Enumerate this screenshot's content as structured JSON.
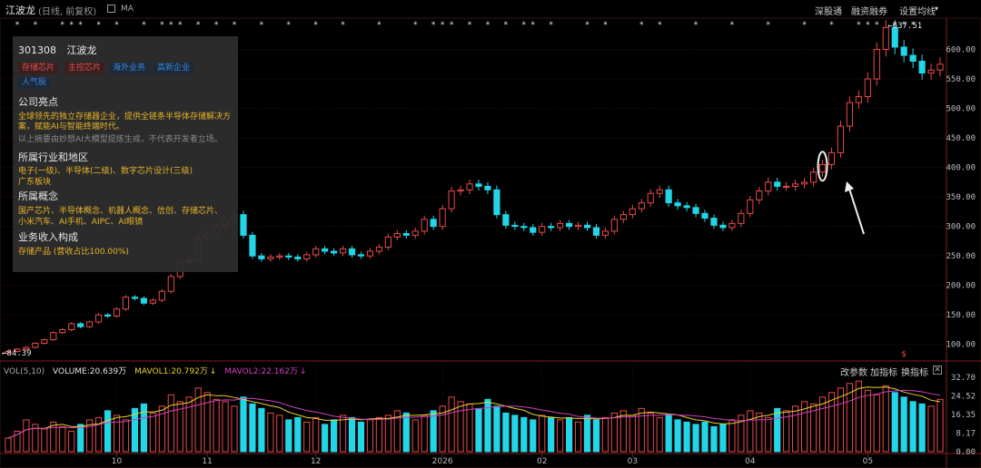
{
  "header": {
    "stock_name": "江波龙",
    "subtitle": "(日线, 前复权)",
    "indicator": "MA",
    "buttons": [
      "深股通",
      "融资融券",
      "设置均线"
    ]
  },
  "info_panel": {
    "code": "301308",
    "name": "江波龙",
    "tags": [
      {
        "label": "存储芯片",
        "color": "red"
      },
      {
        "label": "主控芯片",
        "color": "red"
      },
      {
        "label": "海外业务",
        "color": "blue"
      },
      {
        "label": "高新企业",
        "color": "blue"
      },
      {
        "label": "人气股",
        "color": "blue"
      }
    ],
    "highlights_title": "公司亮点",
    "highlights_line1": "全球领先的独立存储器企业，提供全链条半导体存储解决方",
    "highlights_line2": "案，赋能AI与智能终端时代。",
    "disclaimer": "以上摘要由妙想AI大模型提炼生成，不代表开发者立场。",
    "industry_title": "所属行业和地区",
    "industry_line1": "电子(一级)、半导体(二级)、数字芯片设计(三级)",
    "industry_line2": "广东板块",
    "concepts_title": "所属概念",
    "concepts_line1": "国产芯片、半导体概念、机器人概念、信创、存储芯片、",
    "concepts_line2": "小米汽车、AI手机、AIPC、AI眼镜",
    "revenue_title": "业务收入构成",
    "revenue_text": "存储产品 (营收占比100.00%)"
  },
  "volume_header": {
    "label": "VOL(5,10)",
    "vol": "VOLUME:20.639万",
    "mavol1": "MAVOL1:20.792万",
    "mavol2": "MAVOL2:22.162万",
    "buttons": [
      "改参数",
      "加指标",
      "换指标"
    ],
    "close": "✕"
  },
  "chart_data": {
    "type": "candlestick",
    "price_axis_ticks": [
      "600.00",
      "550.00",
      "500.00",
      "450.00",
      "400.00",
      "350.00",
      "300.00",
      "250.00",
      "200.00",
      "150.00",
      "100.00"
    ],
    "volume_axis_ticks": [
      "32.70",
      "24.52",
      "16.35",
      "8.17",
      "0.00"
    ],
    "x_ticks": [
      {
        "label": "10",
        "index": 12
      },
      {
        "label": "11",
        "index": 22
      },
      {
        "label": "12",
        "index": 34
      },
      {
        "label": "2026",
        "index": 48
      },
      {
        "label": "02",
        "index": 59
      },
      {
        "label": "03",
        "index": 69
      },
      {
        "label": "04",
        "index": 82
      },
      {
        "label": "05",
        "index": 95
      }
    ],
    "price_range": [
      75,
      650
    ],
    "volume_range": [
      0,
      32.7
    ],
    "high_label": "637.51",
    "low_label": "84.39",
    "close": [
      88,
      92,
      95,
      102,
      108,
      120,
      125,
      135,
      130,
      138,
      150,
      148,
      160,
      180,
      178,
      170,
      175,
      190,
      215,
      240,
      242,
      280,
      288,
      300,
      310,
      320,
      285,
      250,
      245,
      248,
      250,
      248,
      245,
      252,
      262,
      258,
      255,
      262,
      252,
      250,
      258,
      265,
      282,
      288,
      285,
      292,
      312,
      300,
      330,
      360,
      362,
      372,
      368,
      362,
      320,
      302,
      300,
      298,
      290,
      300,
      298,
      305,
      300,
      302,
      298,
      285,
      292,
      312,
      320,
      330,
      340,
      356,
      362,
      340,
      335,
      332,
      322,
      314,
      302,
      298,
      305,
      322,
      345,
      360,
      375,
      368,
      368,
      372,
      375,
      392,
      405,
      425,
      470,
      510,
      520,
      550,
      600,
      637,
      604,
      590,
      580,
      560,
      565,
      575
    ],
    "volume": [
      6,
      9,
      14,
      12,
      10,
      13,
      11,
      9,
      12,
      14,
      15,
      18,
      16,
      14,
      19,
      21,
      17,
      20,
      25,
      22,
      24,
      28,
      26,
      23,
      22,
      20,
      24,
      21,
      19,
      17,
      16,
      14,
      15,
      13,
      15,
      12,
      14,
      16,
      15,
      13,
      14,
      15,
      16,
      18,
      17,
      14,
      16,
      18,
      20,
      24,
      22,
      21,
      19,
      23,
      20,
      17,
      16,
      15,
      14,
      16,
      15,
      14,
      15,
      13,
      16,
      14,
      15,
      17,
      18,
      16,
      19,
      17,
      15,
      16,
      14,
      13,
      12,
      13,
      11,
      12,
      14,
      16,
      18,
      17,
      15,
      19,
      18,
      20,
      22,
      21,
      24,
      26,
      28,
      30,
      31,
      27,
      25,
      29,
      26,
      24,
      22,
      21,
      20,
      23
    ],
    "mavol1_label": "MAVOL1",
    "mavol2_label": "MAVOL2",
    "colors": {
      "up": "#e84a4a",
      "down": "#22d6e8",
      "ma1": "#e6d22a",
      "ma2": "#d040c0",
      "grid": "#3a1414"
    },
    "event_marker": "$",
    "top_markers": "* * * * * * *"
  }
}
